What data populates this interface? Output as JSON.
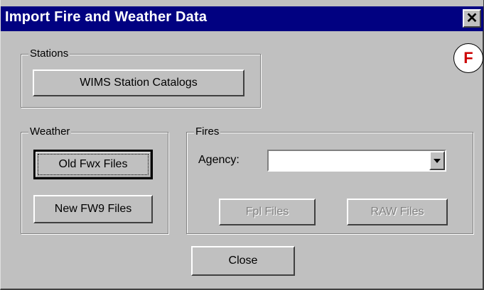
{
  "window": {
    "title": "Import Fire and Weather Data",
    "close_glyph": "✕",
    "help_badge_text": "F"
  },
  "stations": {
    "legend": "Stations",
    "wims_button": "WIMS Station Catalogs"
  },
  "weather": {
    "legend": "Weather",
    "old_fwx_button": "Old Fwx Files",
    "new_fw9_button": "New FW9 Files"
  },
  "fires": {
    "legend": "Fires",
    "agency_label": "Agency:",
    "agency_value": "",
    "fpl_button": "Fpl Files",
    "raw_button": "RAW Files"
  },
  "footer": {
    "close_button": "Close"
  },
  "colors": {
    "titlebar": "#010181",
    "face": "#c0c0c0",
    "help_badge_text": "#cc0000"
  }
}
